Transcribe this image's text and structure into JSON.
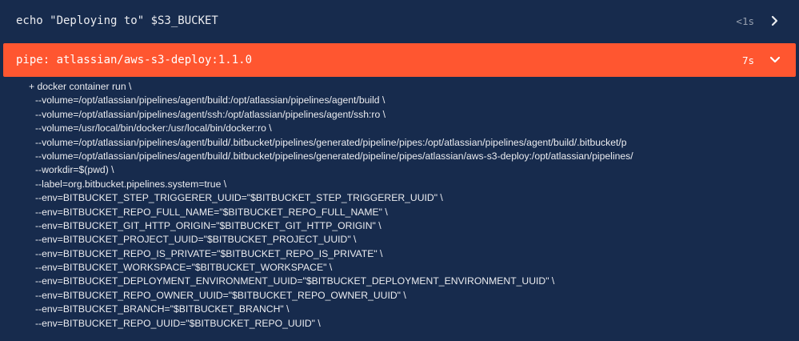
{
  "steps": [
    {
      "command": "echo \"Deploying to\" $S3_BUCKET",
      "duration": "<1s",
      "expanded": false,
      "chevron_icon": "chevron-right-icon"
    },
    {
      "command": "pipe: atlassian/aws-s3-deploy:1.1.0",
      "duration": "7s",
      "expanded": true,
      "status_color": "#ff5630",
      "chevron_icon": "chevron-down-icon"
    }
  ],
  "log_lines": [
    "+ docker container run \\",
    "  --volume=/opt/atlassian/pipelines/agent/build:/opt/atlassian/pipelines/agent/build \\",
    "  --volume=/opt/atlassian/pipelines/agent/ssh:/opt/atlassian/pipelines/agent/ssh:ro \\",
    "  --volume=/usr/local/bin/docker:/usr/local/bin/docker:ro \\",
    "  --volume=/opt/atlassian/pipelines/agent/build/.bitbucket/pipelines/generated/pipeline/pipes:/opt/atlassian/pipelines/agent/build/.bitbucket/p",
    "  --volume=/opt/atlassian/pipelines/agent/build/.bitbucket/pipelines/generated/pipeline/pipes/atlassian/aws-s3-deploy:/opt/atlassian/pipelines/",
    "  --workdir=$(pwd) \\",
    "  --label=org.bitbucket.pipelines.system=true \\",
    "  --env=BITBUCKET_STEP_TRIGGERER_UUID=\"$BITBUCKET_STEP_TRIGGERER_UUID\" \\",
    "  --env=BITBUCKET_REPO_FULL_NAME=\"$BITBUCKET_REPO_FULL_NAME\" \\",
    "  --env=BITBUCKET_GIT_HTTP_ORIGIN=\"$BITBUCKET_GIT_HTTP_ORIGIN\" \\",
    "  --env=BITBUCKET_PROJECT_UUID=\"$BITBUCKET_PROJECT_UUID\" \\",
    "  --env=BITBUCKET_REPO_IS_PRIVATE=\"$BITBUCKET_REPO_IS_PRIVATE\" \\",
    "  --env=BITBUCKET_WORKSPACE=\"$BITBUCKET_WORKSPACE\" \\",
    "  --env=BITBUCKET_DEPLOYMENT_ENVIRONMENT_UUID=\"$BITBUCKET_DEPLOYMENT_ENVIRONMENT_UUID\" \\",
    "  --env=BITBUCKET_REPO_OWNER_UUID=\"$BITBUCKET_REPO_OWNER_UUID\" \\",
    "  --env=BITBUCKET_BRANCH=\"$BITBUCKET_BRANCH\" \\",
    "  --env=BITBUCKET_REPO_UUID=\"$BITBUCKET_REPO_UUID\" \\"
  ]
}
